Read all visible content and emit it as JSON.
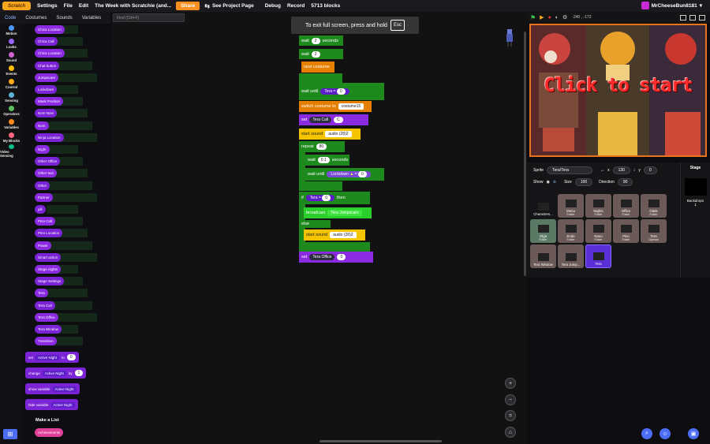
{
  "menu": {
    "logo": "Scratch",
    "settings": "Settings",
    "file": "File",
    "edit": "Edit",
    "project_title": "The Week with Scratchie (and...",
    "share": "Share",
    "see_project_page": "See Project Page",
    "debug": "Debug",
    "record": "Record",
    "block_count": "5713 blocks",
    "username": "MrCheeseBun8181"
  },
  "tabs": [
    "Code",
    "Costumes",
    "Sounds",
    "Variables"
  ],
  "find_placeholder": "Find (Ctrl+F)",
  "fullscreen_toast": {
    "text": "To exit full screen, press and hold",
    "key": "Esc"
  },
  "categories": [
    {
      "label": "Motion",
      "color": "#4c97ff"
    },
    {
      "label": "Looks",
      "color": "#9966ff"
    },
    {
      "label": "Sound",
      "color": "#cf63cf"
    },
    {
      "label": "Events",
      "color": "#ffbf00"
    },
    {
      "label": "Control",
      "color": "#ffab19"
    },
    {
      "label": "Sensing",
      "color": "#5cb1d6"
    },
    {
      "label": "Operators",
      "color": "#59c059"
    },
    {
      "label": "Variables",
      "color": "#ff8c1a"
    },
    {
      "label": "My Blocks",
      "color": "#ff6680"
    },
    {
      "label": "Video Sensing",
      "color": "#0fbd8c"
    }
  ],
  "palette_vars": [
    "Chica Location",
    "Chica Call",
    "Chica Location",
    "Chat button",
    "Jumpscare",
    "Lockdown",
    "Mask Position",
    "Nom Nom",
    "Nom",
    "Ninja Location",
    "Night",
    "Other Office",
    "Other text",
    "Other",
    "Partner",
    "pill",
    "Pino Call",
    "Pino Location",
    "Power",
    "Smart action",
    "Stage nights",
    "Stage Settings",
    "Tera",
    "Tera Call",
    "Tera Office",
    "Tera Window",
    "Transition"
  ],
  "palette_ops": [
    {
      "label": "set",
      "dropdown": "Active Night",
      "extra": "to",
      "value": "0"
    },
    {
      "label": "change",
      "dropdown": "Active Night",
      "extra": "by",
      "value": "1"
    },
    {
      "label": "show variable",
      "dropdown": "Active Night"
    },
    {
      "label": "hide variable",
      "dropdown": "Active Night"
    }
  ],
  "make_list": "Make a List",
  "list_item": "Achievements",
  "script": {
    "wait1": {
      "label": "wait",
      "value": "2",
      "unit": "seconds"
    },
    "wait2": {
      "label": "wait",
      "value": "2"
    },
    "next_costume": "next costume",
    "wait_until": {
      "label": "wait until",
      "var": "Tera",
      "op": "=",
      "value": "0"
    },
    "switch_costume": {
      "label": "switch costume to",
      "value": "costume15"
    },
    "set_call": {
      "label": "set",
      "var": "Tera Call",
      "value": "C"
    },
    "start_sound1": {
      "label": "start sound",
      "value": "audio (28)2"
    },
    "repeat": {
      "label": "repeat",
      "value": "80"
    },
    "wait3": {
      "label": "wait",
      "value": "0.1",
      "unit": "seconds"
    },
    "wait_until2": {
      "label": "wait until",
      "var": "Lockdown",
      "op": "=",
      "value": "0"
    },
    "if": {
      "label": "if",
      "var": "Tera",
      "op": "=",
      "value": "0",
      "then": "then"
    },
    "broadcast": {
      "label": "broadcast",
      "value": "Tera Jumpscare"
    },
    "else": "else",
    "start_sound2": {
      "label": "start sound",
      "value": "audio (28)2"
    },
    "set_office": {
      "label": "set",
      "var": "Tera Office",
      "value": "0"
    }
  },
  "stage_header": {
    "coords": "-240 , -172"
  },
  "stage": {
    "overlay": "Click to start"
  },
  "sprite_info": {
    "sprite_label": "Sprite",
    "sprite_name": "Tera/Tera",
    "x_label": "x",
    "x_value": "130",
    "y_label": "y",
    "y_value": "0",
    "show_label": "Show",
    "size_label": "Size",
    "size_value": "100",
    "direction_label": "Direction",
    "direction_value": "90"
  },
  "sprites": [
    {
      "name": "Characters...",
      "sub": ""
    },
    {
      "name": "Menu",
      "sub": "Folder"
    },
    {
      "name": "Nights",
      "sub": "Folder"
    },
    {
      "name": "Office",
      "sub": "Folder"
    },
    {
      "name": "Odds",
      "sub": "Folder"
    },
    {
      "name": "Olga",
      "sub": "Folder"
    },
    {
      "name": "Endo",
      "sub": "Folder"
    },
    {
      "name": "Nano",
      "sub": "Folder"
    },
    {
      "name": "Pino",
      "sub": "Folder"
    },
    {
      "name": "Tera",
      "sub": "Opened"
    },
    {
      "name": "Tera Window",
      "sub": ""
    },
    {
      "name": "Tera Jump...",
      "sub": ""
    },
    {
      "name": "Tera",
      "sub": ""
    }
  ],
  "stage_pane": {
    "label": "Stage",
    "backdrops_label": "Backdrops",
    "backdrops_count": "1"
  }
}
